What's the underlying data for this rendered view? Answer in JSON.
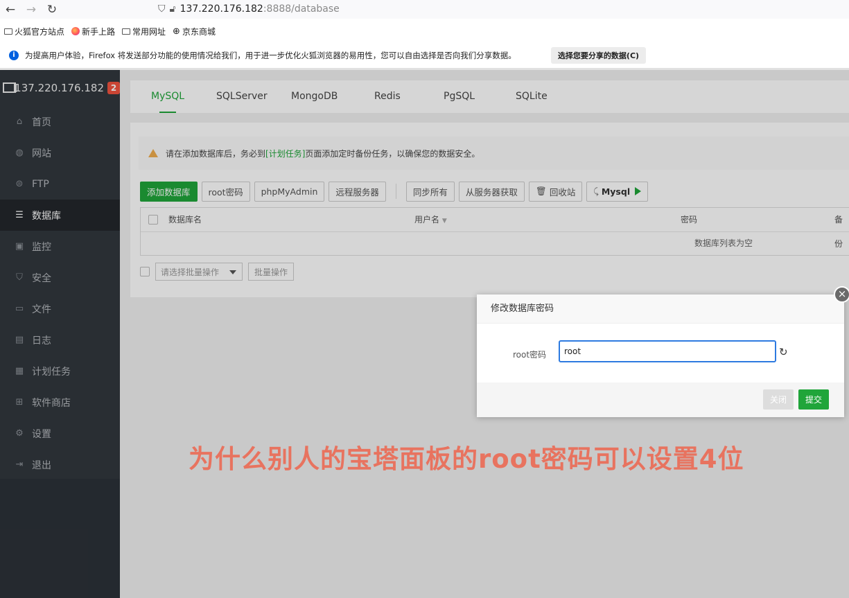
{
  "browser": {
    "url_host": "137.220.176.182",
    "url_rest": ":8888/database",
    "bookmarks": [
      "火狐官方站点",
      "新手上路",
      "常用网址",
      "京东商城"
    ],
    "infobar_text": "为提高用户体验，Firefox 将发送部分功能的使用情况给我们，用于进一步优化火狐浏览器的易用性，您可以自由选择是否向我们分享数据。",
    "infobar_button": "选择您要分享的数据(C)"
  },
  "sidebar": {
    "host": "137.220.176.182",
    "badge": "2",
    "items": [
      {
        "label": "首页",
        "icon": "home-icon"
      },
      {
        "label": "网站",
        "icon": "globe-icon"
      },
      {
        "label": "FTP",
        "icon": "ftp-icon"
      },
      {
        "label": "数据库",
        "icon": "database-icon"
      },
      {
        "label": "监控",
        "icon": "monitor-icon"
      },
      {
        "label": "安全",
        "icon": "shield-icon"
      },
      {
        "label": "文件",
        "icon": "folder-icon"
      },
      {
        "label": "日志",
        "icon": "log-icon"
      },
      {
        "label": "计划任务",
        "icon": "calendar-icon"
      },
      {
        "label": "软件商店",
        "icon": "apps-icon"
      },
      {
        "label": "设置",
        "icon": "gear-icon"
      },
      {
        "label": "退出",
        "icon": "logout-icon"
      }
    ],
    "active_index": 3
  },
  "tabs": [
    "MySQL",
    "SQLServer",
    "MongoDB",
    "Redis",
    "PgSQL",
    "SQLite"
  ],
  "warning": {
    "before": "请在添加数据库后，务必到",
    "link": "[计划任务]",
    "after": "页面添加定时备份任务，以确保您的数据安全。"
  },
  "toolbar": {
    "add_db": "添加数据库",
    "root_pwd": "root密码",
    "phpmyadmin": "phpMyAdmin",
    "remote": "远程服务器",
    "sync_all": "同步所有",
    "fetch_server": "从服务器获取",
    "recycle": "回收站",
    "mysql": "Mysql"
  },
  "table": {
    "col_name": "数据库名",
    "col_user": "用户名",
    "col_pwd": "密码",
    "col_backup": "备份",
    "empty": "数据库列表为空"
  },
  "batch": {
    "select_placeholder": "请选择批量操作",
    "button": "批量操作"
  },
  "dialog": {
    "title": "修改数据库密码",
    "label": "root密码",
    "value": "root",
    "cancel": "关闭",
    "submit": "提交"
  },
  "caption": "为什么别人的宝塔面板的root密码可以设置4位",
  "colors": {
    "accent": "#20a53a",
    "sidebar": "#32373d",
    "caption": "#e8735f",
    "input_focus": "#2d7ae0"
  }
}
